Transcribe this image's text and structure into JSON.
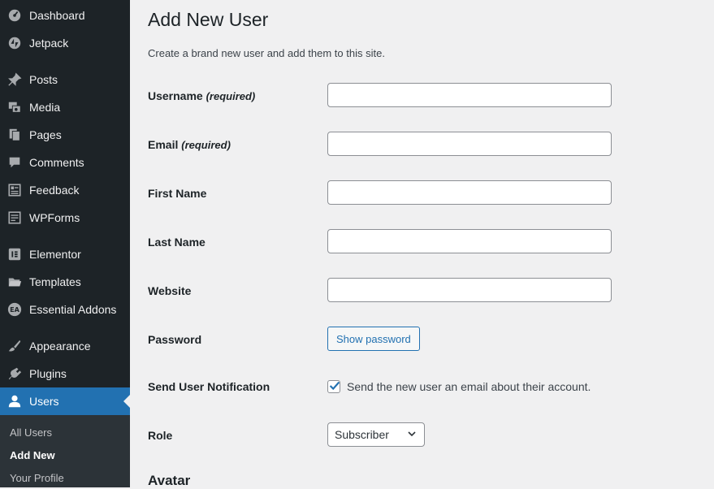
{
  "sidebar": {
    "items": [
      {
        "label": "Dashboard",
        "icon": "dashboard-icon"
      },
      {
        "label": "Jetpack",
        "icon": "jetpack-icon"
      },
      {
        "label": "Posts",
        "icon": "pushpin-icon"
      },
      {
        "label": "Media",
        "icon": "media-icon"
      },
      {
        "label": "Pages",
        "icon": "pages-icon"
      },
      {
        "label": "Comments",
        "icon": "comment-icon"
      },
      {
        "label": "Feedback",
        "icon": "feedback-icon"
      },
      {
        "label": "WPForms",
        "icon": "wpforms-icon"
      },
      {
        "label": "Elementor",
        "icon": "elementor-icon"
      },
      {
        "label": "Templates",
        "icon": "folder-icon"
      },
      {
        "label": "Essential Addons",
        "icon": "ea-icon"
      },
      {
        "label": "Appearance",
        "icon": "brush-icon"
      },
      {
        "label": "Plugins",
        "icon": "plugin-icon"
      },
      {
        "label": "Users",
        "icon": "user-icon",
        "active": true
      }
    ],
    "submenu": [
      {
        "label": "All Users"
      },
      {
        "label": "Add New",
        "current": true
      },
      {
        "label": "Your Profile"
      }
    ]
  },
  "page": {
    "title": "Add New User",
    "description": "Create a brand new user and add them to this site."
  },
  "form": {
    "username_label": "Username",
    "username_required": "(required)",
    "username_value": "",
    "email_label": "Email",
    "email_required": "(required)",
    "email_value": "",
    "first_name_label": "First Name",
    "first_name_value": "",
    "last_name_label": "Last Name",
    "last_name_value": "",
    "website_label": "Website",
    "website_value": "",
    "password_label": "Password",
    "show_password_label": "Show password",
    "notification_label": "Send User Notification",
    "notification_text": "Send the new user an email about their account.",
    "notification_checked": true,
    "role_label": "Role",
    "role_value": "Subscriber",
    "avatar_heading": "Avatar"
  },
  "colors": {
    "sidebar_bg": "#1d2327",
    "accent": "#2271b1",
    "page_bg": "#f0f0f1"
  }
}
